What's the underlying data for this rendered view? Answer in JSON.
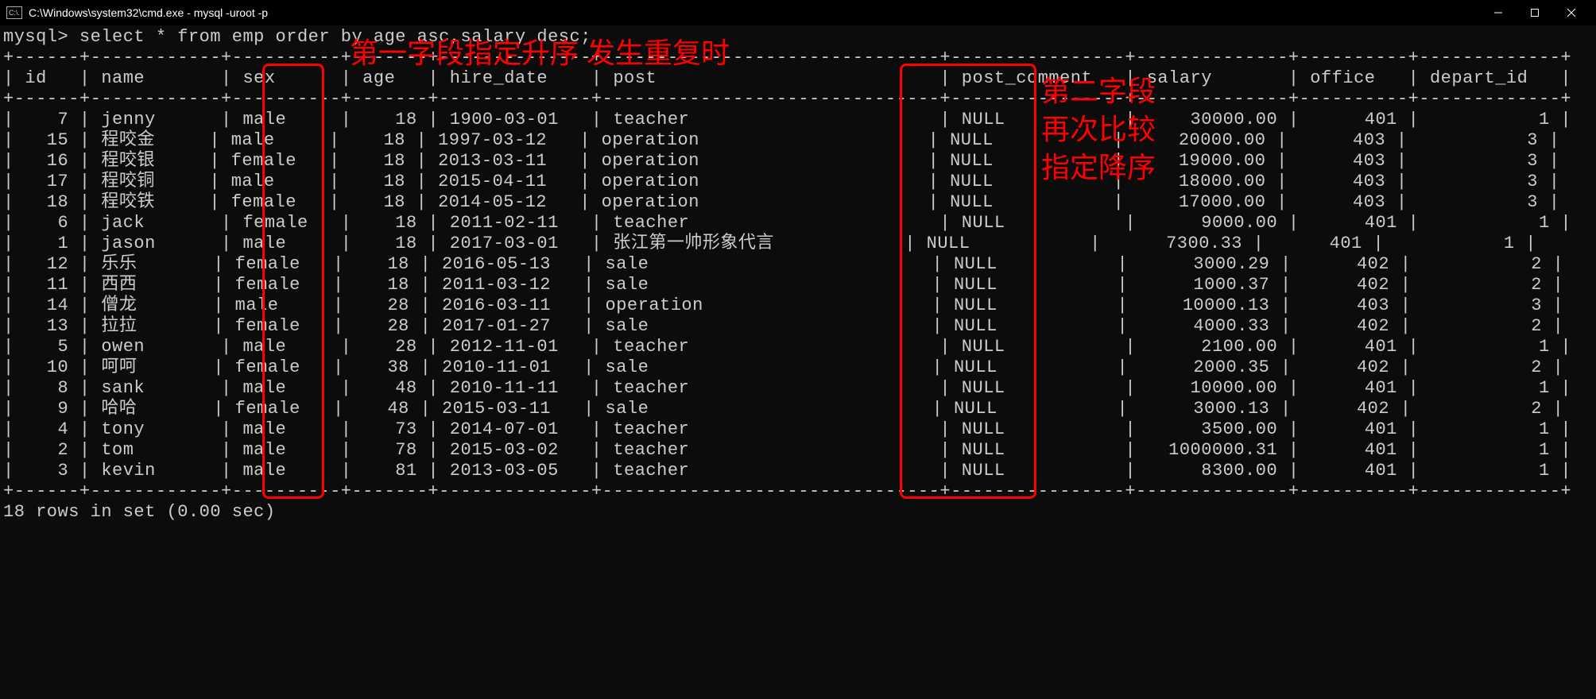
{
  "titlebar": {
    "icon_label": "C:\\.",
    "title": "C:\\Windows\\system32\\cmd.exe - mysql  -uroot -p"
  },
  "prompt": {
    "prefix": "mysql>",
    "command": " select * from emp order by age asc,salary desc;"
  },
  "headers": [
    "id",
    "name",
    "sex",
    "age",
    "hire_date",
    "post",
    "post_comment",
    "salary",
    "office",
    "depart_id"
  ],
  "rows": [
    {
      "id": "7",
      "name": "jenny",
      "sex": "male",
      "age": "18",
      "hire_date": "1900-03-01",
      "post": "teacher",
      "post_comment": "NULL",
      "salary": "30000.00",
      "office": "401",
      "depart_id": "1"
    },
    {
      "id": "15",
      "name": "程咬金",
      "sex": "male",
      "age": "18",
      "hire_date": "1997-03-12",
      "post": "operation",
      "post_comment": "NULL",
      "salary": "20000.00",
      "office": "403",
      "depart_id": "3"
    },
    {
      "id": "16",
      "name": "程咬银",
      "sex": "female",
      "age": "18",
      "hire_date": "2013-03-11",
      "post": "operation",
      "post_comment": "NULL",
      "salary": "19000.00",
      "office": "403",
      "depart_id": "3"
    },
    {
      "id": "17",
      "name": "程咬铜",
      "sex": "male",
      "age": "18",
      "hire_date": "2015-04-11",
      "post": "operation",
      "post_comment": "NULL",
      "salary": "18000.00",
      "office": "403",
      "depart_id": "3"
    },
    {
      "id": "18",
      "name": "程咬铁",
      "sex": "female",
      "age": "18",
      "hire_date": "2014-05-12",
      "post": "operation",
      "post_comment": "NULL",
      "salary": "17000.00",
      "office": "403",
      "depart_id": "3"
    },
    {
      "id": "6",
      "name": "jack",
      "sex": "female",
      "age": "18",
      "hire_date": "2011-02-11",
      "post": "teacher",
      "post_comment": "NULL",
      "salary": "9000.00",
      "office": "401",
      "depart_id": "1"
    },
    {
      "id": "1",
      "name": "jason",
      "sex": "male",
      "age": "18",
      "hire_date": "2017-03-01",
      "post": "张江第一帅形象代言",
      "post_comment": "NULL",
      "salary": "7300.33",
      "office": "401",
      "depart_id": "1"
    },
    {
      "id": "12",
      "name": "乐乐",
      "sex": "female",
      "age": "18",
      "hire_date": "2016-05-13",
      "post": "sale",
      "post_comment": "NULL",
      "salary": "3000.29",
      "office": "402",
      "depart_id": "2"
    },
    {
      "id": "11",
      "name": "西西",
      "sex": "female",
      "age": "18",
      "hire_date": "2011-03-12",
      "post": "sale",
      "post_comment": "NULL",
      "salary": "1000.37",
      "office": "402",
      "depart_id": "2"
    },
    {
      "id": "14",
      "name": "僧龙",
      "sex": "male",
      "age": "28",
      "hire_date": "2016-03-11",
      "post": "operation",
      "post_comment": "NULL",
      "salary": "10000.13",
      "office": "403",
      "depart_id": "3"
    },
    {
      "id": "13",
      "name": "拉拉",
      "sex": "female",
      "age": "28",
      "hire_date": "2017-01-27",
      "post": "sale",
      "post_comment": "NULL",
      "salary": "4000.33",
      "office": "402",
      "depart_id": "2"
    },
    {
      "id": "5",
      "name": "owen",
      "sex": "male",
      "age": "28",
      "hire_date": "2012-11-01",
      "post": "teacher",
      "post_comment": "NULL",
      "salary": "2100.00",
      "office": "401",
      "depart_id": "1"
    },
    {
      "id": "10",
      "name": "呵呵",
      "sex": "female",
      "age": "38",
      "hire_date": "2010-11-01",
      "post": "sale",
      "post_comment": "NULL",
      "salary": "2000.35",
      "office": "402",
      "depart_id": "2"
    },
    {
      "id": "8",
      "name": "sank",
      "sex": "male",
      "age": "48",
      "hire_date": "2010-11-11",
      "post": "teacher",
      "post_comment": "NULL",
      "salary": "10000.00",
      "office": "401",
      "depart_id": "1"
    },
    {
      "id": "9",
      "name": "哈哈",
      "sex": "female",
      "age": "48",
      "hire_date": "2015-03-11",
      "post": "sale",
      "post_comment": "NULL",
      "salary": "3000.13",
      "office": "402",
      "depart_id": "2"
    },
    {
      "id": "4",
      "name": "tony",
      "sex": "male",
      "age": "73",
      "hire_date": "2014-07-01",
      "post": "teacher",
      "post_comment": "NULL",
      "salary": "3500.00",
      "office": "401",
      "depart_id": "1"
    },
    {
      "id": "2",
      "name": "tom",
      "sex": "male",
      "age": "78",
      "hire_date": "2015-03-02",
      "post": "teacher",
      "post_comment": "NULL",
      "salary": "1000000.31",
      "office": "401",
      "depart_id": "1"
    },
    {
      "id": "3",
      "name": "kevin",
      "sex": "male",
      "age": "81",
      "hire_date": "2013-03-05",
      "post": "teacher",
      "post_comment": "NULL",
      "salary": "8300.00",
      "office": "401",
      "depart_id": "1"
    }
  ],
  "footer": "18 rows in set (0.00 sec)",
  "annotations": {
    "top": "第一字段指定升序 发生重复时",
    "right1": "第二字段",
    "right2": "再次比较",
    "right3": "指定降序"
  },
  "col_widths": {
    "id": 4,
    "name": 10,
    "sex": 8,
    "age": 5,
    "hire_date": 12,
    "post": 29,
    "post_comment": 14,
    "salary": 12,
    "office": 8,
    "depart_id": 11
  }
}
